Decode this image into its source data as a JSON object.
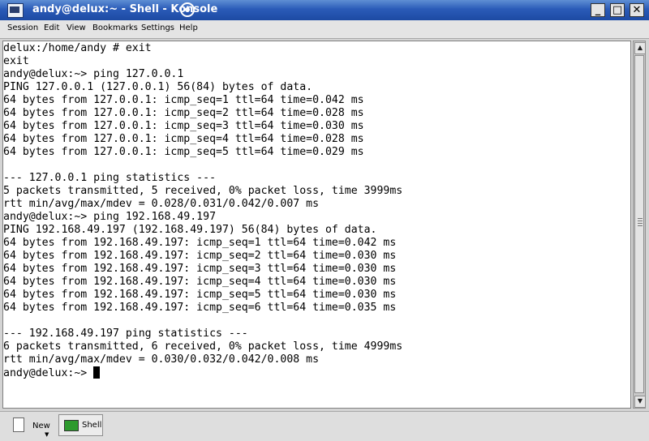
{
  "window": {
    "title": "andy@delux:~ - Shell - Konsole",
    "icon": "konsole-terminal-icon",
    "kde_icon": "kde-logo-icon",
    "buttons": {
      "minimize": "_",
      "maximize": "□",
      "close": "✕"
    }
  },
  "menu": [
    "Session",
    "Edit",
    "View",
    "Bookmarks",
    "Settings",
    "Help"
  ],
  "terminal": {
    "lines": [
      "delux:/home/andy # exit",
      "exit",
      "andy@delux:~> ping 127.0.0.1",
      "PING 127.0.0.1 (127.0.0.1) 56(84) bytes of data.",
      "64 bytes from 127.0.0.1: icmp_seq=1 ttl=64 time=0.042 ms",
      "64 bytes from 127.0.0.1: icmp_seq=2 ttl=64 time=0.028 ms",
      "64 bytes from 127.0.0.1: icmp_seq=3 ttl=64 time=0.030 ms",
      "64 bytes from 127.0.0.1: icmp_seq=4 ttl=64 time=0.028 ms",
      "64 bytes from 127.0.0.1: icmp_seq=5 ttl=64 time=0.029 ms",
      "",
      "--- 127.0.0.1 ping statistics ---",
      "5 packets transmitted, 5 received, 0% packet loss, time 3999ms",
      "rtt min/avg/max/mdev = 0.028/0.031/0.042/0.007 ms",
      "andy@delux:~> ping 192.168.49.197",
      "PING 192.168.49.197 (192.168.49.197) 56(84) bytes of data.",
      "64 bytes from 192.168.49.197: icmp_seq=1 ttl=64 time=0.042 ms",
      "64 bytes from 192.168.49.197: icmp_seq=2 ttl=64 time=0.030 ms",
      "64 bytes from 192.168.49.197: icmp_seq=3 ttl=64 time=0.030 ms",
      "64 bytes from 192.168.49.197: icmp_seq=4 ttl=64 time=0.030 ms",
      "64 bytes from 192.168.49.197: icmp_seq=5 ttl=64 time=0.030 ms",
      "64 bytes from 192.168.49.197: icmp_seq=6 ttl=64 time=0.035 ms",
      "",
      "--- 192.168.49.197 ping statistics ---",
      "6 packets transmitted, 6 received, 0% packet loss, time 4999ms",
      "rtt min/avg/max/mdev = 0.030/0.032/0.042/0.008 ms"
    ],
    "prompt": "andy@delux:~> ",
    "cursor_visible": true
  },
  "tabs": {
    "new_label": "New",
    "new_icon": "new-session-icon",
    "items": [
      {
        "label": "Shell",
        "icon": "shell-icon",
        "active": true
      }
    ]
  },
  "colors": {
    "titlebar_start": "#5f8fd4",
    "titlebar_end": "#1d4aa3",
    "terminal_bg": "#ffffff",
    "terminal_fg": "#000000"
  }
}
